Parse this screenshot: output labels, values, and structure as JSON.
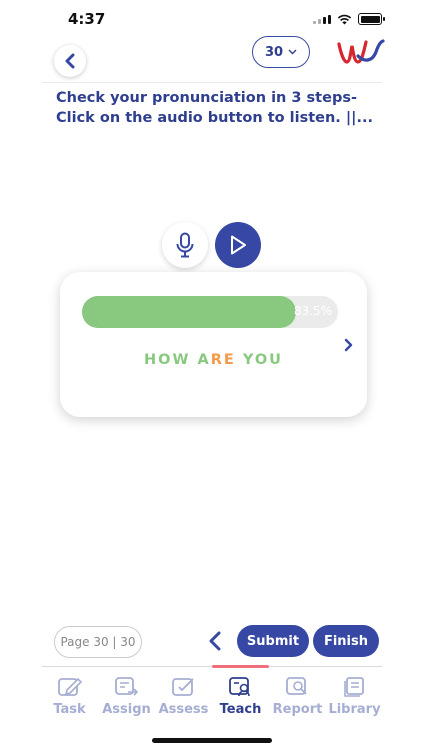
{
  "status": {
    "time": "4:37"
  },
  "header": {
    "back_icon": "chevron-left-icon",
    "question_count": "30",
    "logo_icon": "w-brand-logo"
  },
  "instructions": "Check your pronunciation in 3 steps- Click on the audio button to listen. ||...",
  "audio": {
    "mic_icon": "microphone-icon",
    "play_icon": "play-icon"
  },
  "card": {
    "progress_percent": 83.5,
    "progress_label": "83.5%",
    "phrase_parts": [
      "HOW A",
      "RE",
      " YOU"
    ],
    "colors": {
      "correct": "#88c97f",
      "incorrect": "#f39a4a",
      "fill": "#88c97f"
    }
  },
  "footer": {
    "page_label": "Page 30 | 30",
    "submit_label": "Submit",
    "finish_label": "Finish"
  },
  "tabs": [
    {
      "label": "Task",
      "icon": "edit-icon"
    },
    {
      "label": "Assign",
      "icon": "assign-icon"
    },
    {
      "label": "Assess",
      "icon": "assess-icon"
    },
    {
      "label": "Teach",
      "icon": "teach-icon",
      "active": true
    },
    {
      "label": "Report",
      "icon": "report-icon"
    },
    {
      "label": "Library",
      "icon": "library-icon"
    }
  ],
  "accent": "#3648a3"
}
